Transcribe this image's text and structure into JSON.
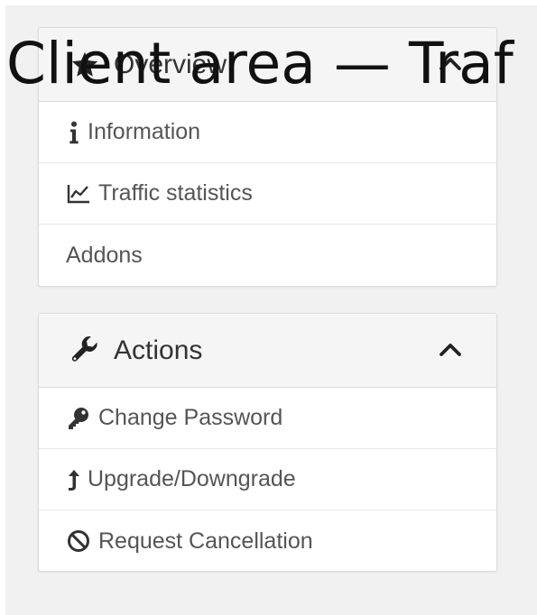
{
  "page": {
    "title": "Client area — Traf"
  },
  "overview": {
    "heading": "Overview",
    "items": [
      {
        "label": "Information",
        "icon": "info-icon"
      },
      {
        "label": "Traffic statistics",
        "icon": "line-chart-icon"
      },
      {
        "label": "Addons",
        "icon": ""
      }
    ]
  },
  "actions": {
    "heading": "Actions",
    "items": [
      {
        "label": "Change Password",
        "icon": "key-icon"
      },
      {
        "label": "Upgrade/Downgrade",
        "icon": "level-up-icon"
      },
      {
        "label": "Request Cancellation",
        "icon": "ban-icon"
      }
    ]
  },
  "colors": {
    "background": "#f1f1f1",
    "panel_bg": "#ffffff",
    "heading_bg": "#f5f5f5",
    "border": "#dcdcdc",
    "text": "#555555",
    "heading_text": "#333333"
  }
}
